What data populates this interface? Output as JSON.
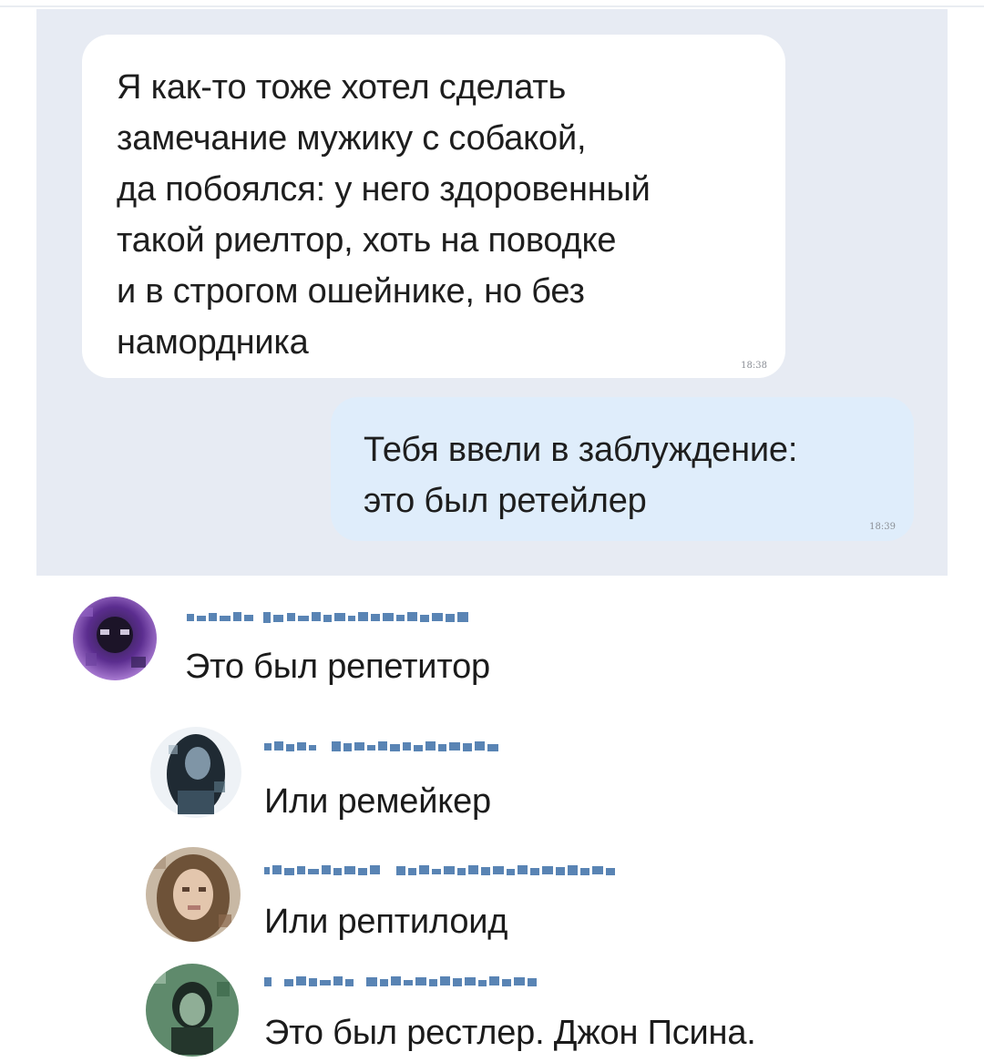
{
  "conversation": {
    "incoming": {
      "text": "Я как-то тоже хотел сделать\nзамечание мужику с собакой,\nда побоялся: у него здоровенный\nтакой риелтор, хоть на поводке\nи в строгом ошейнике, но без\nнамордника",
      "time": "18:38"
    },
    "outgoing": {
      "text": "Тебя ввели в заблуждение:\nэто был ретейлер",
      "time": "18:39"
    }
  },
  "comments": [
    {
      "text": "Это был репетитор",
      "avatar_icon": "user-avatar-icon"
    },
    {
      "text": "Или ремейкер",
      "avatar_icon": "user-avatar-icon"
    },
    {
      "text": "Или рептилоид",
      "avatar_icon": "user-avatar-icon"
    },
    {
      "text": "Это был рестлер. Джон Псина.",
      "avatar_icon": "user-avatar-icon"
    }
  ],
  "colors": {
    "chat_background": "#e7ebf3",
    "incoming_bubble": "#ffffff",
    "outgoing_bubble": "#dfedfb",
    "author_name": "#3d6fa8"
  }
}
